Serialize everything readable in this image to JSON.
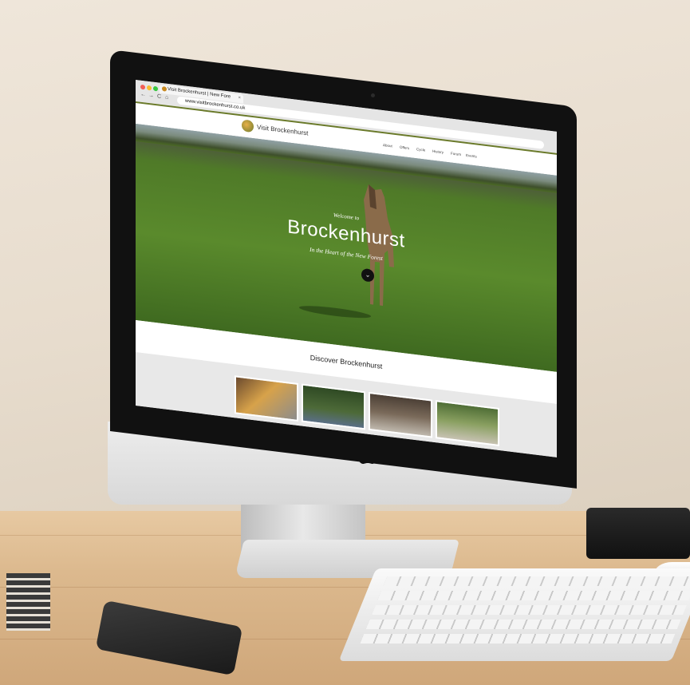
{
  "browser": {
    "tab_title": "Visit Brockenhurst | New Fore",
    "tab_close": "×",
    "url": "www.visitbrockenhurst.co.uk",
    "nav_back": "←",
    "nav_forward": "→",
    "nav_reload": "C",
    "nav_home": "⌂"
  },
  "site": {
    "logo_text": "Visit Brockenhurst",
    "nav": [
      "About",
      "Offers",
      "Cycle",
      "History",
      "Forum",
      "Events"
    ]
  },
  "hero": {
    "welcome": "Welcome to",
    "title": "Brockenhurst",
    "subtitle": "In the Heart of the New Forest",
    "scroll_button": "⌄"
  },
  "discover": {
    "heading": "Discover Brockenhurst"
  },
  "colors": {
    "header_accent": "#6a7a2a",
    "hero_green": "#5a8a2c",
    "scroll_button": "#111111"
  }
}
